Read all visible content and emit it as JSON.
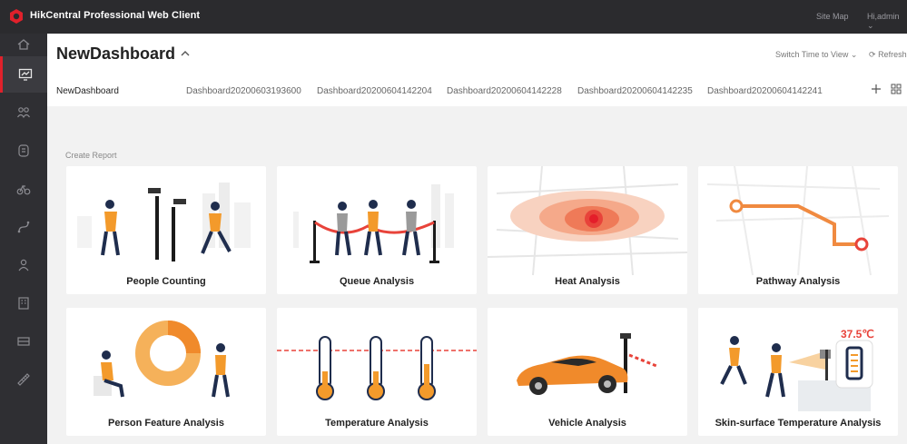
{
  "app": {
    "title": "HikCentral Professional Web Client",
    "site_map": "Site Map",
    "user": "Hi,admin"
  },
  "sidebar": {
    "items": [
      "home",
      "dashboard",
      "people",
      "face",
      "vehicle",
      "pathway",
      "person",
      "building",
      "gate",
      "ruler"
    ]
  },
  "header": {
    "title": "NewDashboard",
    "switch_time": "Switch Time to View",
    "refresh": "Refresh",
    "tabs": [
      {
        "label": "NewDashboard"
      },
      {
        "label": "Dashboard20200603193600"
      },
      {
        "label": "Dashboard20200604142204"
      },
      {
        "label": "Dashboard20200604142228"
      },
      {
        "label": "Dashboard20200604142235"
      },
      {
        "label": "Dashboard20200604142241"
      }
    ]
  },
  "content": {
    "section_label": "Create Report",
    "cards": [
      {
        "label": "People Counting"
      },
      {
        "label": "Queue Analysis"
      },
      {
        "label": "Heat Analysis"
      },
      {
        "label": "Pathway Analysis"
      },
      {
        "label": "Person Feature Analysis"
      },
      {
        "label": "Temperature Analysis"
      },
      {
        "label": "Vehicle Analysis"
      },
      {
        "label": "Skin-surface Temperature Analysis"
      }
    ],
    "temperature_reading": "37.5℃"
  },
  "colors": {
    "accent": "#e0212b",
    "orange": "#f39a2b",
    "navy": "#1f2d4d",
    "red": "#e8433a"
  }
}
